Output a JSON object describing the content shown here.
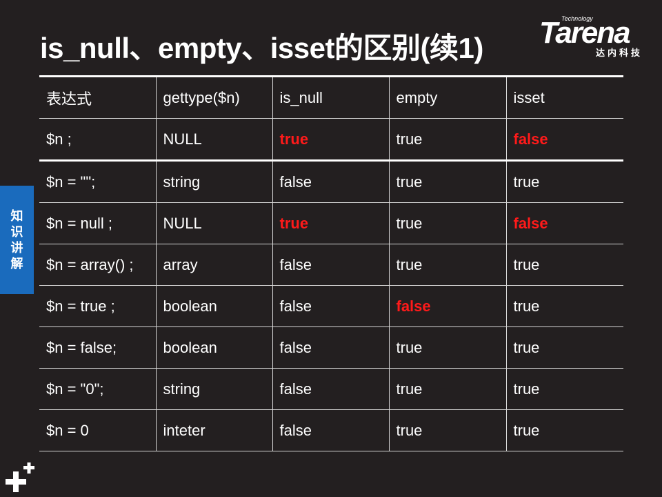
{
  "slide": {
    "title": "is_null、empty、isset的区别(续1)",
    "side_tab_chars": [
      "知",
      "识",
      "讲",
      "解"
    ]
  },
  "logo": {
    "small": "Technology",
    "main": "Tarena",
    "sub": "达内科技"
  },
  "table": {
    "headers": [
      "表达式",
      "gettype($n)",
      "is_null",
      "empty",
      "isset"
    ],
    "rows": [
      [
        "$n ;",
        "NULL",
        "true",
        "true",
        "false"
      ],
      [
        "$n = \"\";",
        "string",
        "false",
        "true",
        "true"
      ],
      [
        "$n = null ;",
        "NULL",
        "true",
        "true",
        "false"
      ],
      [
        "$n = array() ;",
        "array",
        "false",
        "true",
        "true"
      ],
      [
        "$n = true ;",
        "boolean",
        "false",
        "false",
        "true"
      ],
      [
        "$n = false;",
        "boolean",
        "false",
        "true",
        "true"
      ],
      [
        "$n = \"0\";",
        "string",
        "false",
        "true",
        "true"
      ],
      [
        "$n = 0",
        "inteter",
        "false",
        "true",
        "true"
      ]
    ]
  },
  "colors": {
    "background": "#231f20",
    "highlight": "#ff1a1a",
    "side_tab": "#1a6bbd"
  },
  "icons": {
    "corner": "plus-logo-icon"
  }
}
